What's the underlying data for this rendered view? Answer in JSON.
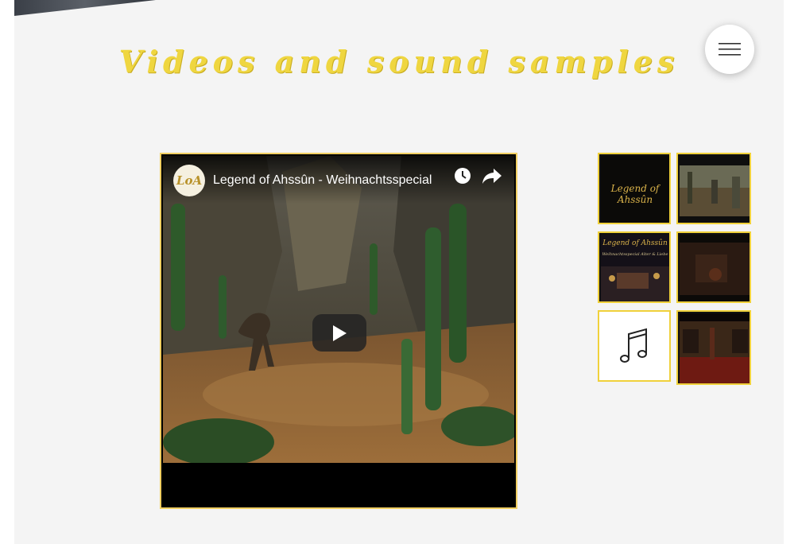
{
  "page": {
    "title": "Videos and sound samples"
  },
  "header": {
    "menu_icon": "hamburger-menu-icon"
  },
  "video": {
    "channel_logo_text": "LoA",
    "title": "Legend of Ahssûn - Weihnachtsspecial",
    "watch_later_icon": "clock-icon",
    "share_icon": "share-icon",
    "play_icon": "play-icon"
  },
  "gallery": {
    "items": [
      {
        "kind": "video",
        "caption": "Legend of Ahssûn"
      },
      {
        "kind": "video",
        "caption": ""
      },
      {
        "kind": "video",
        "caption": "Legend of Ahssûn",
        "subcaption": "Weihnachtsspecial Alter & Liebe"
      },
      {
        "kind": "video",
        "caption": ""
      },
      {
        "kind": "audio",
        "icon": "music-note-icon"
      },
      {
        "kind": "video",
        "caption": ""
      }
    ]
  },
  "colors": {
    "accent": "#efd640",
    "thumb_border": "#f0d13b",
    "video_border": "#f1cf62",
    "panel_bg": "#f4f4f4"
  }
}
